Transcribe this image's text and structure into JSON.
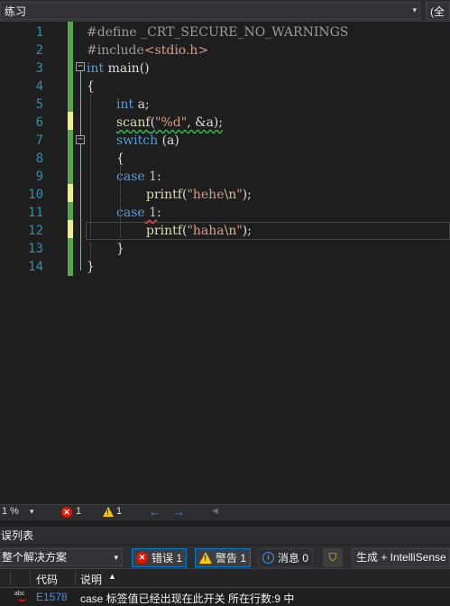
{
  "navbar": {
    "project": "练习",
    "scope_right": "(全"
  },
  "editor": {
    "line_numbers": [
      "1",
      "2",
      "3",
      "4",
      "5",
      "6",
      "7",
      "8",
      "9",
      "10",
      "11",
      "12",
      "13",
      "14"
    ],
    "lines": {
      "l1_directive": "#define",
      "l1_macro": " _CRT_SECURE_NO_WARNINGS",
      "l2_directive": "#include",
      "l2_header": "<stdio.h>",
      "l3_kw": "int",
      "l3_rest": " main()",
      "l4": "{",
      "l5_kw": "int",
      "l5_rest": " a;",
      "l6_fn": "scanf",
      "l6_open": "(",
      "l6_str": "\"%d\"",
      "l6_rest": ", &a);",
      "l7_kw": "switch",
      "l7_rest": " (a)",
      "l8": "{",
      "l9_kw": "case",
      "l9_num": " 1",
      "l9_rest": ":",
      "l10_fn": "printf",
      "l10_open": "(",
      "l10_str1": "\"hehe",
      "l10_esc": "\\n",
      "l10_str2": "\"",
      "l10_rest": ");",
      "l11_kw": "case",
      "l11_num": " 1",
      "l11_rest": ":",
      "l12_fn": "printf",
      "l12_open": "(",
      "l12_str1": "\"haha",
      "l12_esc": "\\n",
      "l12_str2": "\"",
      "l12_rest": ");",
      "l13": "}",
      "l14": "}"
    }
  },
  "status": {
    "zoom": "1 %",
    "errors": "1",
    "warnings": "1"
  },
  "error_list": {
    "title": "误列表",
    "scope": "整个解决方案",
    "errors_btn": "错误 1",
    "warnings_btn": "警告 1",
    "messages_btn": "消息 0",
    "build_source": "生成 + IntelliSense",
    "col_code": "代码",
    "col_desc": "说明",
    "rows": [
      {
        "code": "E1578",
        "description": "case 标签值已经出现在此开关 所在行数:9 中"
      }
    ]
  },
  "colors": {
    "background": "#1e1e1e",
    "keyword": "#569cd6",
    "string": "#d69d85",
    "line_number": "#2b91af",
    "change_saved": "#57a64a",
    "change_unsaved": "#efef8a",
    "error_red": "#e51400",
    "accent_blue": "#007acc"
  },
  "icons": [
    "dropdown-arrow-icon",
    "fold-collapse-icon",
    "error-icon",
    "warning-icon",
    "info-icon",
    "arrow-left-icon",
    "arrow-right-icon",
    "filter-icon",
    "sort-asc-icon",
    "spellcheck-error-icon"
  ]
}
